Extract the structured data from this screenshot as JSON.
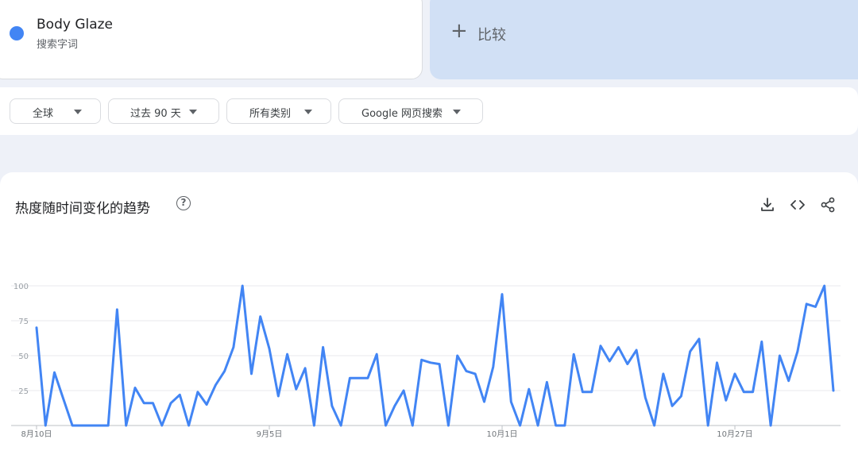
{
  "search_term": {
    "name": "Body Glaze",
    "subtitle": "搜索字词",
    "color": "#4285f4"
  },
  "compare": {
    "plus": "+",
    "label": "比较"
  },
  "filters": [
    {
      "label": "全球"
    },
    {
      "label": "过去 90 天"
    },
    {
      "label": "所有类别"
    },
    {
      "label": "Google 网页搜索"
    }
  ],
  "chart_panel": {
    "title": "热度随时间变化的趋势",
    "help": "?",
    "actions": [
      "download-icon",
      "embed-icon",
      "share-icon"
    ]
  },
  "chart_data": {
    "type": "line",
    "title": "",
    "xlabel": "",
    "ylabel": "",
    "ylim": [
      0,
      100
    ],
    "yticks": [
      "100",
      "75",
      "50",
      "25"
    ],
    "xtick_labels": [
      {
        "label": "8月10日",
        "index": 0
      },
      {
        "label": "9月5日",
        "index": 26
      },
      {
        "label": "10月1日",
        "index": 52
      },
      {
        "label": "10月27日",
        "index": 78
      }
    ],
    "series": [
      {
        "color": "#4285f4",
        "values": [
          70,
          0,
          38,
          19,
          0,
          0,
          0,
          0,
          0,
          83,
          0,
          27,
          16,
          16,
          0,
          16,
          22,
          0,
          24,
          15,
          29,
          39,
          56,
          100,
          37,
          78,
          55,
          21,
          51,
          26,
          41,
          0,
          56,
          14,
          0,
          34,
          34,
          34,
          51,
          0,
          14,
          25,
          0,
          47,
          45,
          44,
          0,
          50,
          39,
          37,
          17,
          42,
          94,
          17,
          0,
          26,
          0,
          31,
          0,
          0,
          51,
          24,
          24,
          57,
          46,
          56,
          44,
          54,
          20,
          0,
          37,
          14,
          21,
          53,
          62,
          0,
          45,
          18,
          37,
          24,
          24,
          60,
          0,
          50,
          32,
          53,
          87,
          85,
          100,
          25
        ]
      }
    ]
  }
}
